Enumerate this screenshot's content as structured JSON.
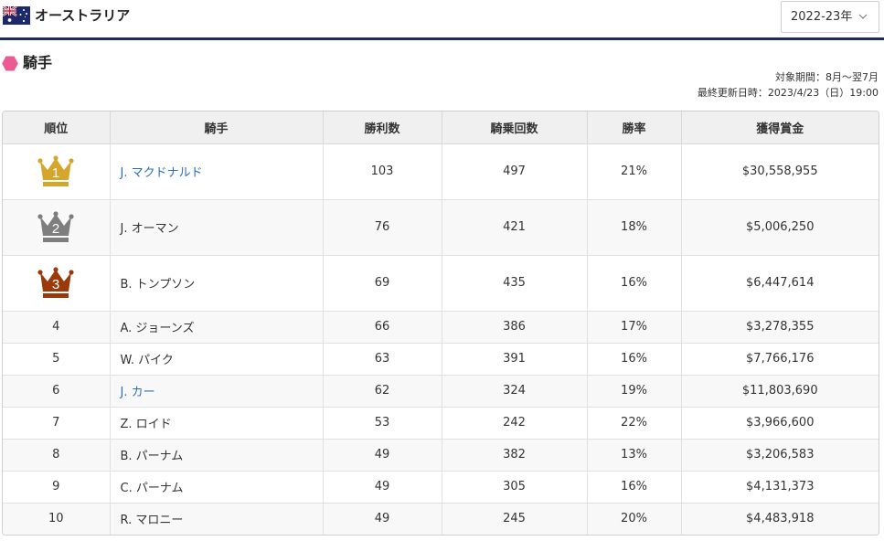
{
  "header": {
    "country": "オーストラリア",
    "season": "2022-23年"
  },
  "section": {
    "title": "騎手",
    "period": "対象期間：8月～翌7月",
    "updated": "最終更新日時：2023/4/23（日）19:00"
  },
  "colors": {
    "navy": "#1c2a6b",
    "gold": "#d4a72c",
    "silver": "#7e7e7e",
    "bronze": "#9a3a0a",
    "link": "#2a6fb7",
    "pink": "#ec5a93"
  },
  "table": {
    "headers": [
      "順位",
      "騎手",
      "勝利数",
      "騎乗回数",
      "勝率",
      "獲得賞金"
    ],
    "rows": [
      {
        "rank": "1",
        "jockey": "J. マクドナルド",
        "wins": "103",
        "rides": "497",
        "rate": "21%",
        "prize": "$30,558,955"
      },
      {
        "rank": "2",
        "jockey": "J. オーマン",
        "wins": "76",
        "rides": "421",
        "rate": "18%",
        "prize": "$5,006,250"
      },
      {
        "rank": "3",
        "jockey": "B. トンプソン",
        "wins": "69",
        "rides": "435",
        "rate": "16%",
        "prize": "$6,447,614"
      },
      {
        "rank": "4",
        "jockey": "A. ジョーンズ",
        "wins": "66",
        "rides": "386",
        "rate": "17%",
        "prize": "$3,278,355"
      },
      {
        "rank": "5",
        "jockey": "W. パイク",
        "wins": "63",
        "rides": "391",
        "rate": "16%",
        "prize": "$7,766,176"
      },
      {
        "rank": "6",
        "jockey": "J. カー",
        "wins": "62",
        "rides": "324",
        "rate": "19%",
        "prize": "$11,803,690"
      },
      {
        "rank": "7",
        "jockey": "Z. ロイド",
        "wins": "53",
        "rides": "242",
        "rate": "22%",
        "prize": "$3,966,600"
      },
      {
        "rank": "8",
        "jockey": "B. パーナム",
        "wins": "49",
        "rides": "382",
        "rate": "13%",
        "prize": "$3,206,583"
      },
      {
        "rank": "9",
        "jockey": "C. パーナム",
        "wins": "49",
        "rides": "305",
        "rate": "16%",
        "prize": "$4,131,373"
      },
      {
        "rank": "10",
        "jockey": "R. マロニー",
        "wins": "49",
        "rides": "245",
        "rate": "20%",
        "prize": "$4,483,918"
      }
    ]
  }
}
